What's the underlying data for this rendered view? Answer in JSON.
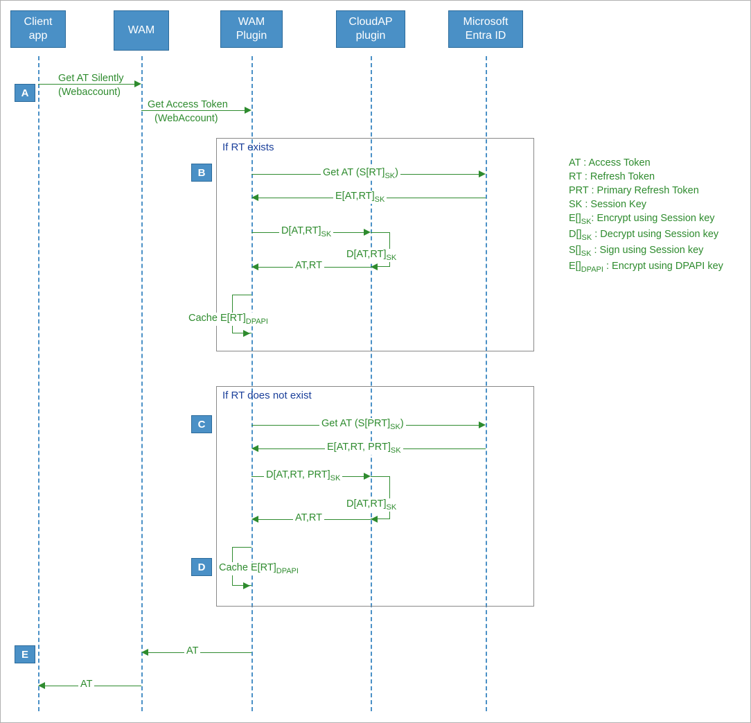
{
  "participants": {
    "client": "Client app",
    "wam": "WAM",
    "wam_plugin": "WAM Plugin",
    "cloudap": "CloudAP plugin",
    "entra": "Microsoft Entra ID"
  },
  "steps": {
    "A": "A",
    "B": "B",
    "C": "C",
    "D": "D",
    "E": "E"
  },
  "messages": {
    "a1_line1": "Get AT Silently",
    "a1_line2": "(Webaccount)",
    "a2_line1": "Get Access Token",
    "a2_line2": "(WebAccount)",
    "alt1_title": "If RT exists",
    "alt2_title": "If RT does not exist",
    "b1": "Get AT (S[RT]",
    "b1_sub": "SK",
    "b1_close": ")",
    "b2_pre": "E[AT,RT]",
    "b2_sub": "SK",
    "b3_pre": "D[AT,RT]",
    "b3_sub": "SK",
    "b4_pre": "D[AT,RT]",
    "b4_sub": "SK",
    "b5": "AT,RT",
    "b6_pre": "Cache E[RT]",
    "b6_sub": "DPAPI",
    "c1": "Get AT (S[PRT]",
    "c1_sub": "SK",
    "c1_close": ")",
    "c2_pre": "E[AT,RT, PRT]",
    "c2_sub": "SK",
    "c3_pre": "D[AT,RT, PRT]",
    "c3_sub": "SK",
    "c4_pre": "D[AT,RT]",
    "c4_sub": "SK",
    "c5": "AT,RT",
    "d1_pre": "Cache E[RT]",
    "d1_sub": "DPAPI",
    "e1": "AT",
    "e2": "AT"
  },
  "glossary": {
    "at": "AT : Access Token",
    "rt": "RT : Refresh Token",
    "prt": "PRT : Primary Refresh Token",
    "sk": "SK : Session Key",
    "esk_pre": "E[]",
    "esk_sub": "SK",
    "esk_post": ": Encrypt using Session key",
    "dsk_pre": "D[]",
    "dsk_sub": "SK",
    "dsk_post": " : Decrypt using Session key",
    "ssk_pre": "S[]",
    "ssk_sub": "SK",
    "ssk_post": " : Sign using Session key",
    "edp_pre": "E[]",
    "edp_sub": "DPAPI",
    "edp_post": " : Encrypt using DPAPI key"
  }
}
